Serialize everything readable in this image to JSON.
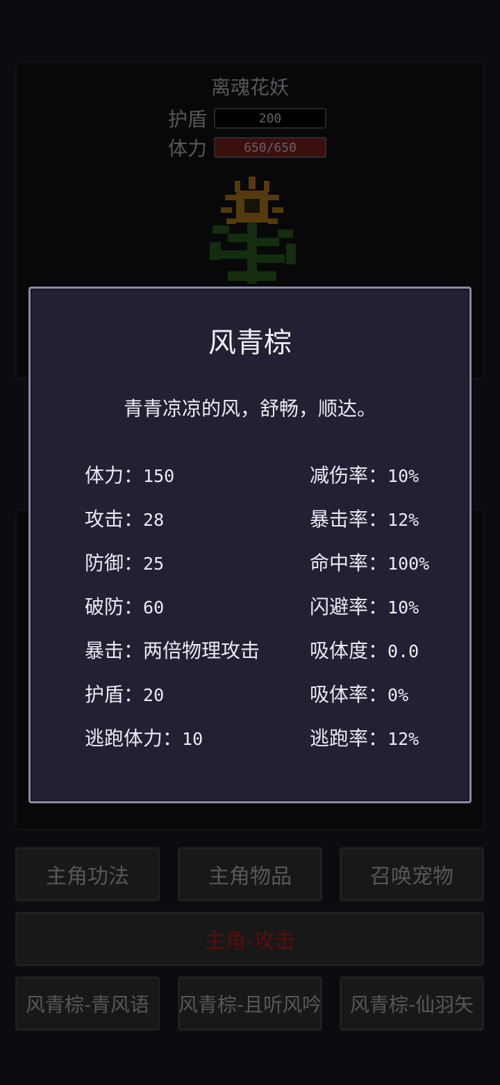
{
  "enemy": {
    "name": "离魂花妖",
    "shield_label": "护盾",
    "shield_value": "200",
    "hp_label": "体力",
    "hp_value": "650/650"
  },
  "buttons": {
    "skills": "主角功法",
    "items": "主角物品",
    "summon": "召唤宠物",
    "attack": "主角-攻击",
    "skill1": "风青棕-青风语",
    "skill2": "风青棕-且听风吟",
    "skill3": "风青棕-仙羽矢"
  },
  "pet_info": {
    "title": "风青棕",
    "description": "青青凉凉的风，舒畅，顺达。",
    "left": [
      {
        "label": "体力：",
        "value": "150"
      },
      {
        "label": "攻击：",
        "value": "28"
      },
      {
        "label": "防御：",
        "value": "25"
      },
      {
        "label": "破防：",
        "value": "60"
      },
      {
        "label": "暴击：",
        "value": "两倍物理攻击"
      },
      {
        "label": "护盾：",
        "value": "20"
      },
      {
        "label": "逃跑体力：",
        "value": "10"
      }
    ],
    "right": [
      {
        "label": "减伤率：",
        "value": "10%"
      },
      {
        "label": "暴击率：",
        "value": "12%"
      },
      {
        "label": "命中率：",
        "value": "100%"
      },
      {
        "label": "闪避率：",
        "value": "10%"
      },
      {
        "label": "吸体度：",
        "value": "0.0"
      },
      {
        "label": "吸体率：",
        "value": "0%"
      },
      {
        "label": "逃跑率：",
        "value": "12%"
      }
    ]
  },
  "colors": {
    "modal_bg": "#241f33",
    "modal_border": "#8a8aa6",
    "hp_bar": "#8e2323",
    "attack_text": "#d42020"
  }
}
